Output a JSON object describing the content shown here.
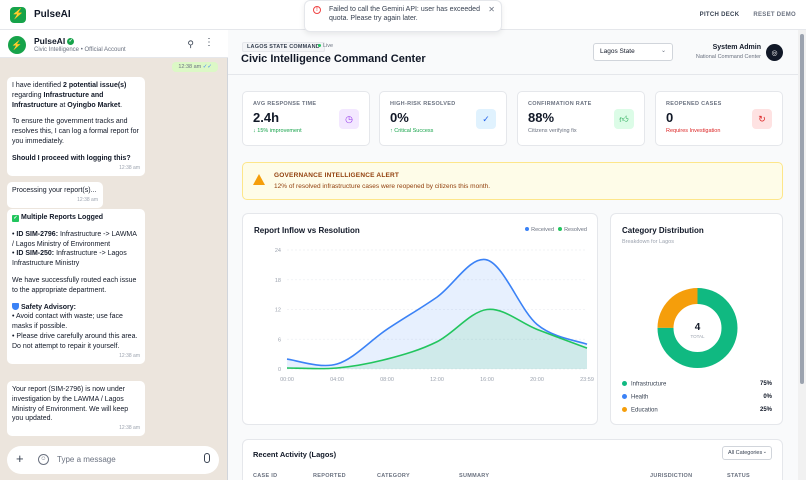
{
  "app": {
    "title": "PulseAI"
  },
  "topbar": {
    "pitch_deck": "PITCH DECK",
    "reset_demo": "RESET DEMO"
  },
  "toast": {
    "message": "Failed to call the Gemini API: user has exceeded quota. Please try again later."
  },
  "chat": {
    "name": "PulseAI",
    "subtitle": "Civic Intelligence • Official Account",
    "prev_out": {
      "time": "12:38 am"
    },
    "messages": [
      {
        "p1_pre": "I have identified ",
        "p1_b1": "2 potential issue(s)",
        "p1_mid": " regarding ",
        "p1_b2": "Infrastructure and Infrastructure",
        "p1_mid2": " at ",
        "p1_b3": "Oyingbo Market",
        "p1_end": ".",
        "p2": "To ensure the government tracks and resolves this, I can log a formal report for you immediately.",
        "p3": "Should I proceed with logging this?",
        "time": "12:38 am"
      },
      {
        "text": "Processing your report(s)...",
        "time": "12:38 am"
      },
      {
        "title": "Multiple Reports Logged",
        "r1_id": "ID SIM-2796:",
        "r1_text": " Infrastructure -> LAWMA / Lagos Ministry of Environment",
        "r2_id": "ID SIM-250:",
        "r2_text": " Infrastructure -> Lagos Infrastructure Ministry",
        "routed": "We have successfully routed each issue to the appropriate department.",
        "advisory_title": "Safety Advisory:",
        "advisory_1": "• Avoid contact with waste; use face masks if possible.",
        "advisory_2": "• Please drive carefully around this area. Do not attempt to repair it yourself.",
        "time": "12:38 am"
      },
      {
        "text": "Your report (SIM-2796) is now under investigation by the LAWMA / Lagos Ministry of Environment. We will keep you updated.",
        "time": "12:38 am"
      }
    ],
    "input_placeholder": "Type a message"
  },
  "dashboard": {
    "tag": "LAGOS STATE COMMAND",
    "live": "Live",
    "title": "Civic Intelligence Command Center",
    "state_select": "Lagos State",
    "admin_name": "System Admin",
    "admin_sub": "National Command Center",
    "kpis": [
      {
        "label": "AVG RESPONSE TIME",
        "value": "2.4h",
        "sub": "↓ 15% improvement",
        "sub_color": "#16a34a",
        "icon": "clock-icon",
        "icon_bg": "#f3e8ff",
        "icon_color": "#9333ea"
      },
      {
        "label": "HIGH-RISK RESOLVED",
        "value": "0%",
        "sub": "↑ Critical Success",
        "sub_color": "#16a34a",
        "icon": "check-circle-icon",
        "icon_bg": "#e0f2fe",
        "icon_color": "#2563eb"
      },
      {
        "label": "CONFIRMATION RATE",
        "value": "88%",
        "sub": "Citizens verifying fix",
        "sub_color": "#6b7280",
        "icon": "thumbs-up-icon",
        "icon_bg": "#dcfce7",
        "icon_color": "#16a34a"
      },
      {
        "label": "REOPENED CASES",
        "value": "0",
        "sub": "Requires Investigation",
        "sub_color": "#dc2626",
        "icon": "refresh-icon",
        "icon_bg": "#fee2e2",
        "icon_color": "#dc2626"
      }
    ],
    "alert": {
      "title": "GOVERNANCE INTELLIGENCE ALERT",
      "message": "12% of resolved infrastructure cases were reopened by citizens this month."
    },
    "recent": {
      "title": "Recent Activity (Lagos)",
      "filter": "All Categories",
      "columns": [
        "CASE ID",
        "REPORTED",
        "CATEGORY",
        "SUMMARY",
        "JURISDICTION",
        "STATUS"
      ]
    }
  },
  "chart_data": [
    {
      "type": "area",
      "title": "Report Inflow vs Resolution",
      "x": [
        "00:00",
        "04:00",
        "08:00",
        "12:00",
        "16:00",
        "20:00",
        "23:59"
      ],
      "ylim": [
        0,
        24
      ],
      "yticks": [
        "24",
        "18",
        "12",
        "6",
        "0"
      ],
      "series": [
        {
          "name": "Received",
          "color": "#3b82f6",
          "values": [
            2,
            1,
            8,
            14.5,
            22,
            9,
            5
          ]
        },
        {
          "name": "Resolved",
          "color": "#22c55e",
          "values": [
            0.2,
            0.2,
            2,
            5.5,
            12,
            8,
            4.2
          ]
        }
      ]
    },
    {
      "type": "pie",
      "title": "Category Distribution",
      "subtitle": "Breakdown for Lagos",
      "center_value": "4",
      "center_label": "TOTAL",
      "slices": [
        {
          "label": "Infrastructure",
          "value": 75,
          "display": "75%",
          "color": "#10b981"
        },
        {
          "label": "Health",
          "value": 0,
          "display": "0%",
          "color": "#3b82f6"
        },
        {
          "label": "Education",
          "value": 25,
          "display": "25%",
          "color": "#f59e0b"
        }
      ]
    }
  ]
}
